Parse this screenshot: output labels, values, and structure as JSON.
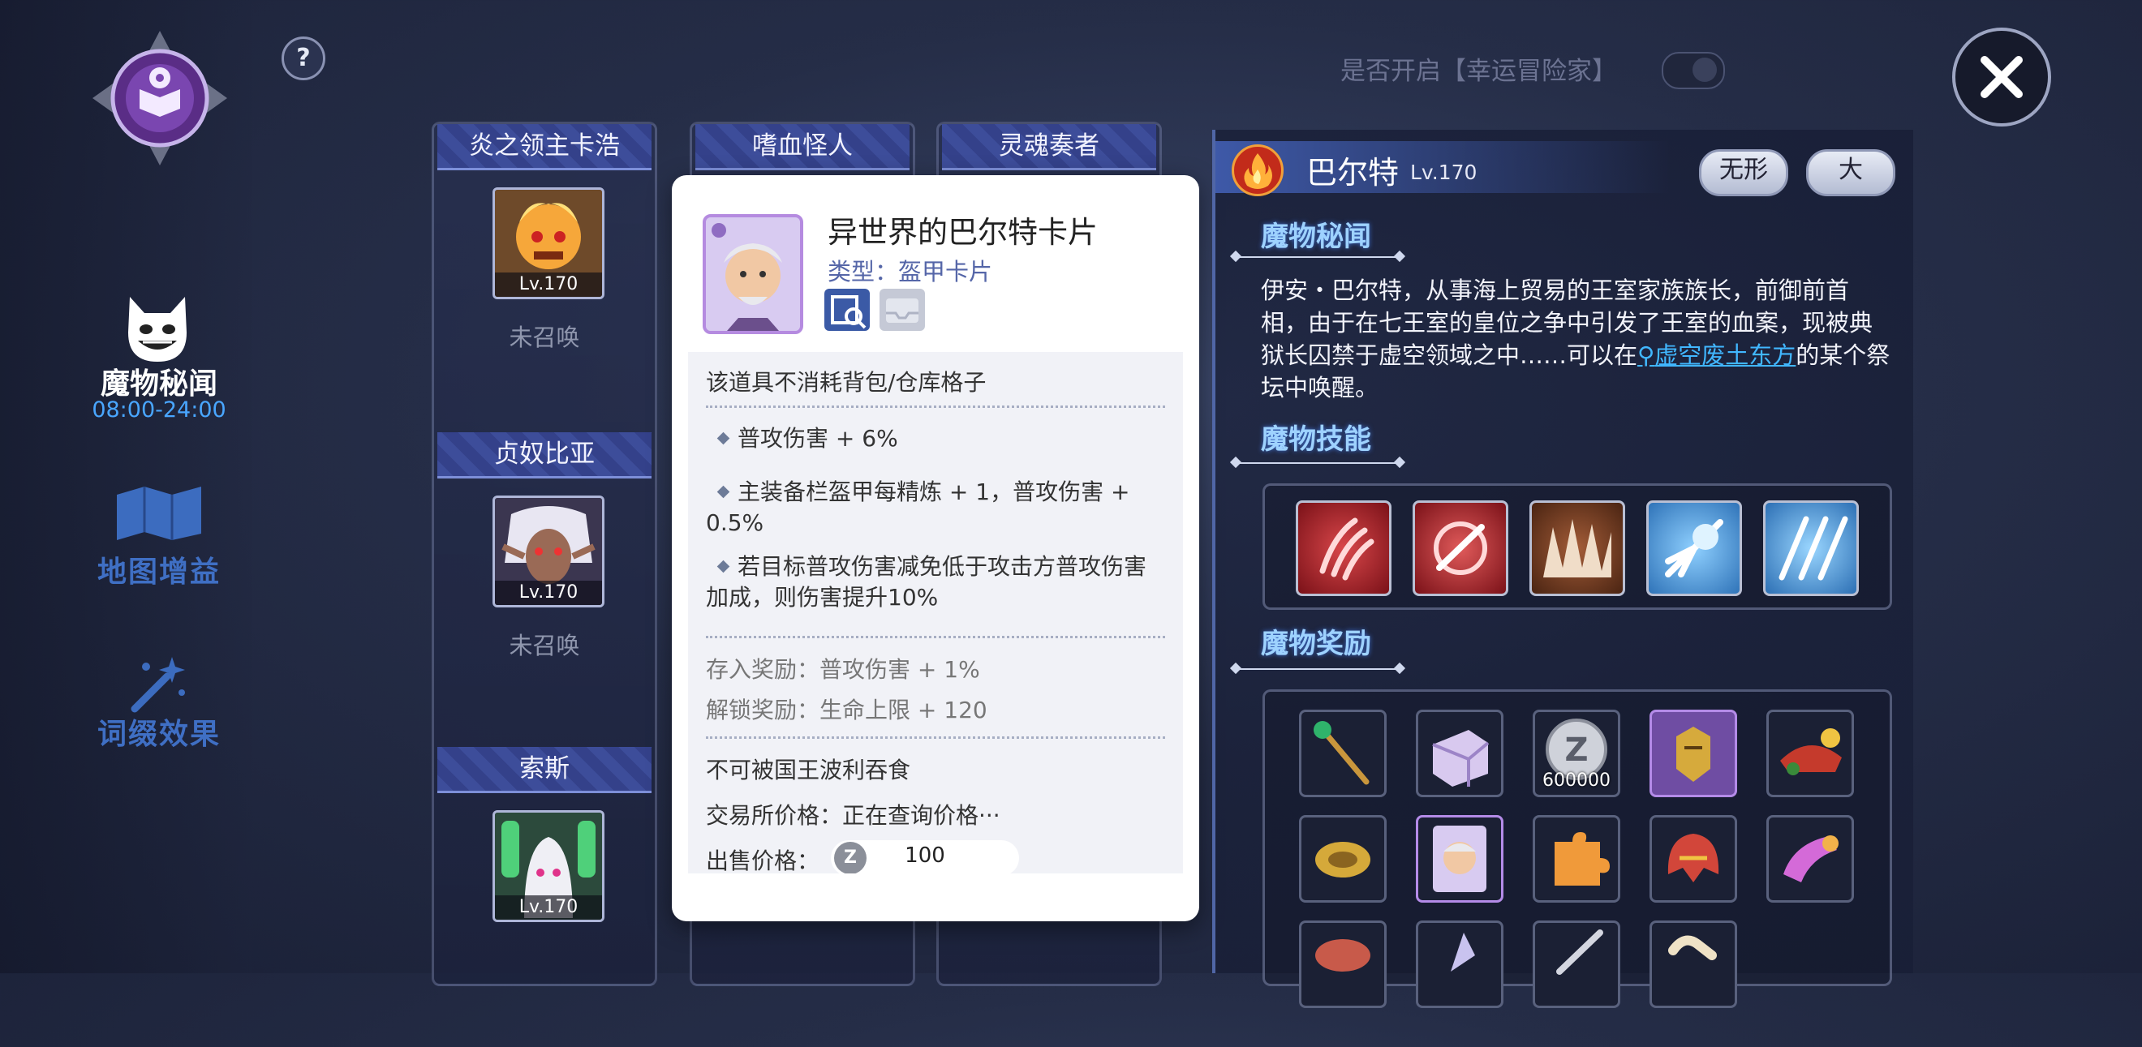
{
  "sidebar": {
    "items": [
      {
        "label": "魔物秘闻",
        "time": "08:00-24:00"
      },
      {
        "label": "地图增益"
      },
      {
        "label": "词缀效果"
      }
    ]
  },
  "header": {
    "help": "?",
    "lucky_toggle_label": "是否开启【幸运冒险家】",
    "lucky_toggle_on": false
  },
  "columns": [
    {
      "cards": [
        {
          "name": "炎之领主卡浩",
          "level": "Lv.170",
          "status": "未召唤"
        },
        {
          "name": "贞奴比亚",
          "level": "Lv.170",
          "status": "未召唤"
        },
        {
          "name": "索斯",
          "level": "Lv.170",
          "status": ""
        }
      ]
    },
    {
      "cards": [
        {
          "name": "嗜血怪人"
        }
      ]
    },
    {
      "cards": [
        {
          "name": "灵魂奏者"
        }
      ]
    }
  ],
  "popup": {
    "title": "异世界的巴尔特卡片",
    "type": "类型：盔甲卡片",
    "note": "该道具不消耗背包/仓库格子",
    "bullets": [
      "普攻伤害 + 6%",
      "主装备栏盔甲每精炼 + 1，普攻伤害 + 0.5%",
      "若目标普攻伤害减免低于攻击方普攻伤害加成，则伤害提升10%"
    ],
    "deposit_reward": "存入奖励：普攻伤害 + 1%",
    "unlock_reward": "解锁奖励：生命上限 + 120",
    "not_devour": "不可被国王波利吞食",
    "exchange_price": "交易所价格：正在查询价格···",
    "sell_label": "出售价格：",
    "sell_value": "100"
  },
  "monster": {
    "name": "巴尔特",
    "level": "Lv.170",
    "tags": [
      "无形",
      "大"
    ],
    "lore_title": "魔物秘闻",
    "lore_text": "伊安・巴尔特，从事海上贸易的王室家族族长，前御前首相，由于在七王室的皇位之争中引发了王室的血案，现被典狱长囚禁于虚空领域之中……可以在",
    "lore_link": "虚空废土东方",
    "lore_tail": "的某个祭坛中唤醒。",
    "skills_title": "魔物技能",
    "rewards_title": "魔物奖励",
    "reward_zeny": "600000"
  },
  "colors": {
    "accent": "#3f6fc4",
    "section": "#9ed2ff",
    "link": "#41b7ff"
  }
}
